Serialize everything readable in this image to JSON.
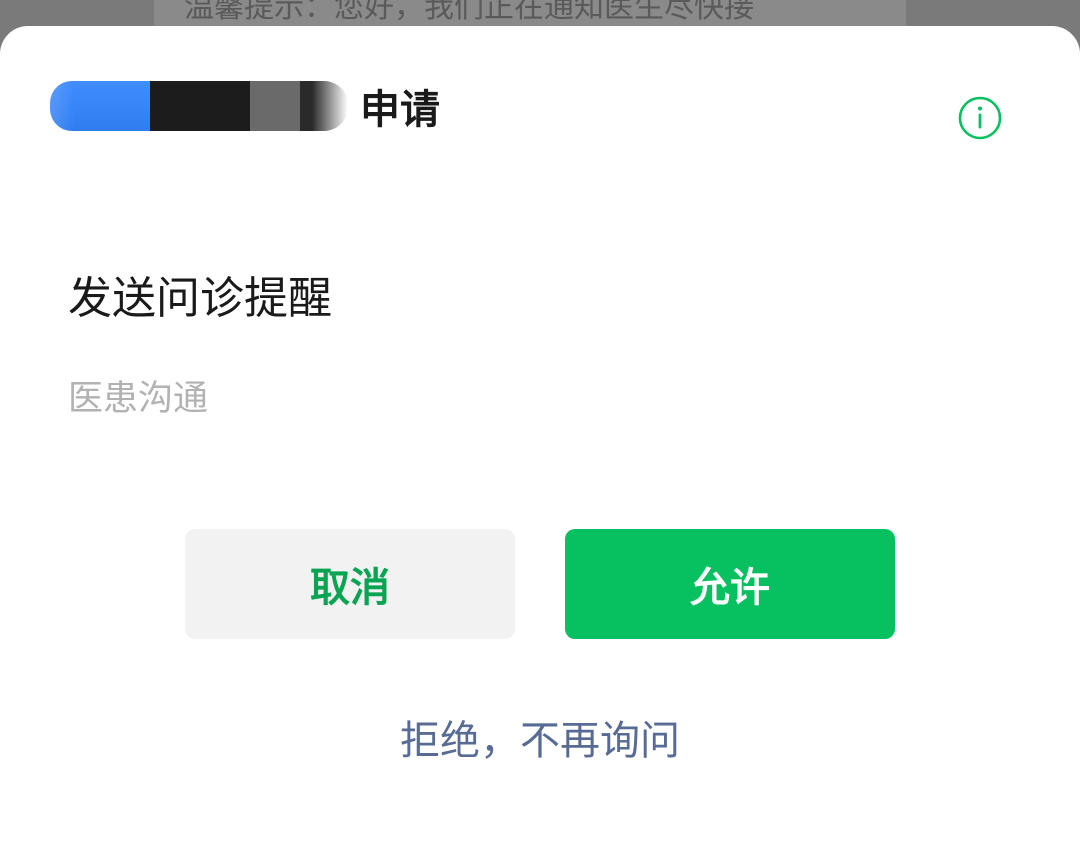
{
  "background": {
    "notice_text": "温馨提示：您好，我们正在通知医生尽快接"
  },
  "dialog": {
    "header_title": "申请",
    "info_icon": "info-circle-icon",
    "title": "发送问诊提醒",
    "subtitle": "医患沟通",
    "cancel_label": "取消",
    "allow_label": "允许",
    "reject_label": "拒绝，不再询问"
  },
  "colors": {
    "accent_green": "#07c160",
    "cancel_text_green": "#07a552",
    "link_blue": "#576b95",
    "secondary_text": "#b2b2b2"
  }
}
